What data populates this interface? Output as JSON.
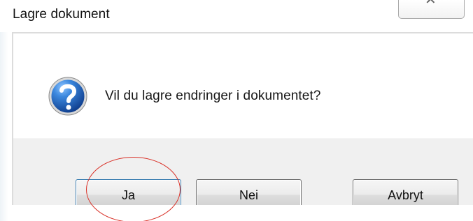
{
  "window": {
    "title": "Lagre dokument",
    "close_icon": "close-icon"
  },
  "dialog": {
    "icon": "question-icon",
    "message": "Vil du lagre endringer i dokumentet?",
    "buttons": {
      "yes": "Ja",
      "no": "Nei",
      "cancel": "Avbryt"
    }
  },
  "colors": {
    "icon_blue": "#1f5fa8",
    "annotation_red": "#d93128",
    "button_bar": "#f0f0f0"
  }
}
